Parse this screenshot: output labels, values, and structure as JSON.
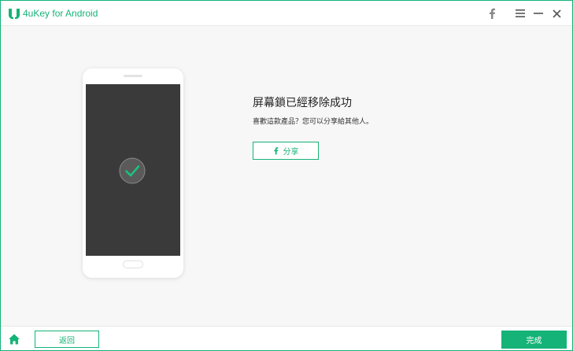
{
  "app": {
    "title": "4uKey for Android",
    "accent_color": "#15b377"
  },
  "titlebar": {
    "icons": [
      "facebook-icon",
      "menu-icon",
      "minimize-icon",
      "close-icon"
    ]
  },
  "main": {
    "success_title": "屏幕鎖已經移除成功",
    "success_subtitle": "喜歡這款產品？您可以分享給其他人。",
    "share_label": "分享",
    "phone_status_icon": "check-icon"
  },
  "bottombar": {
    "home_icon": "home-icon",
    "back_label": "返回",
    "done_label": "完成"
  }
}
